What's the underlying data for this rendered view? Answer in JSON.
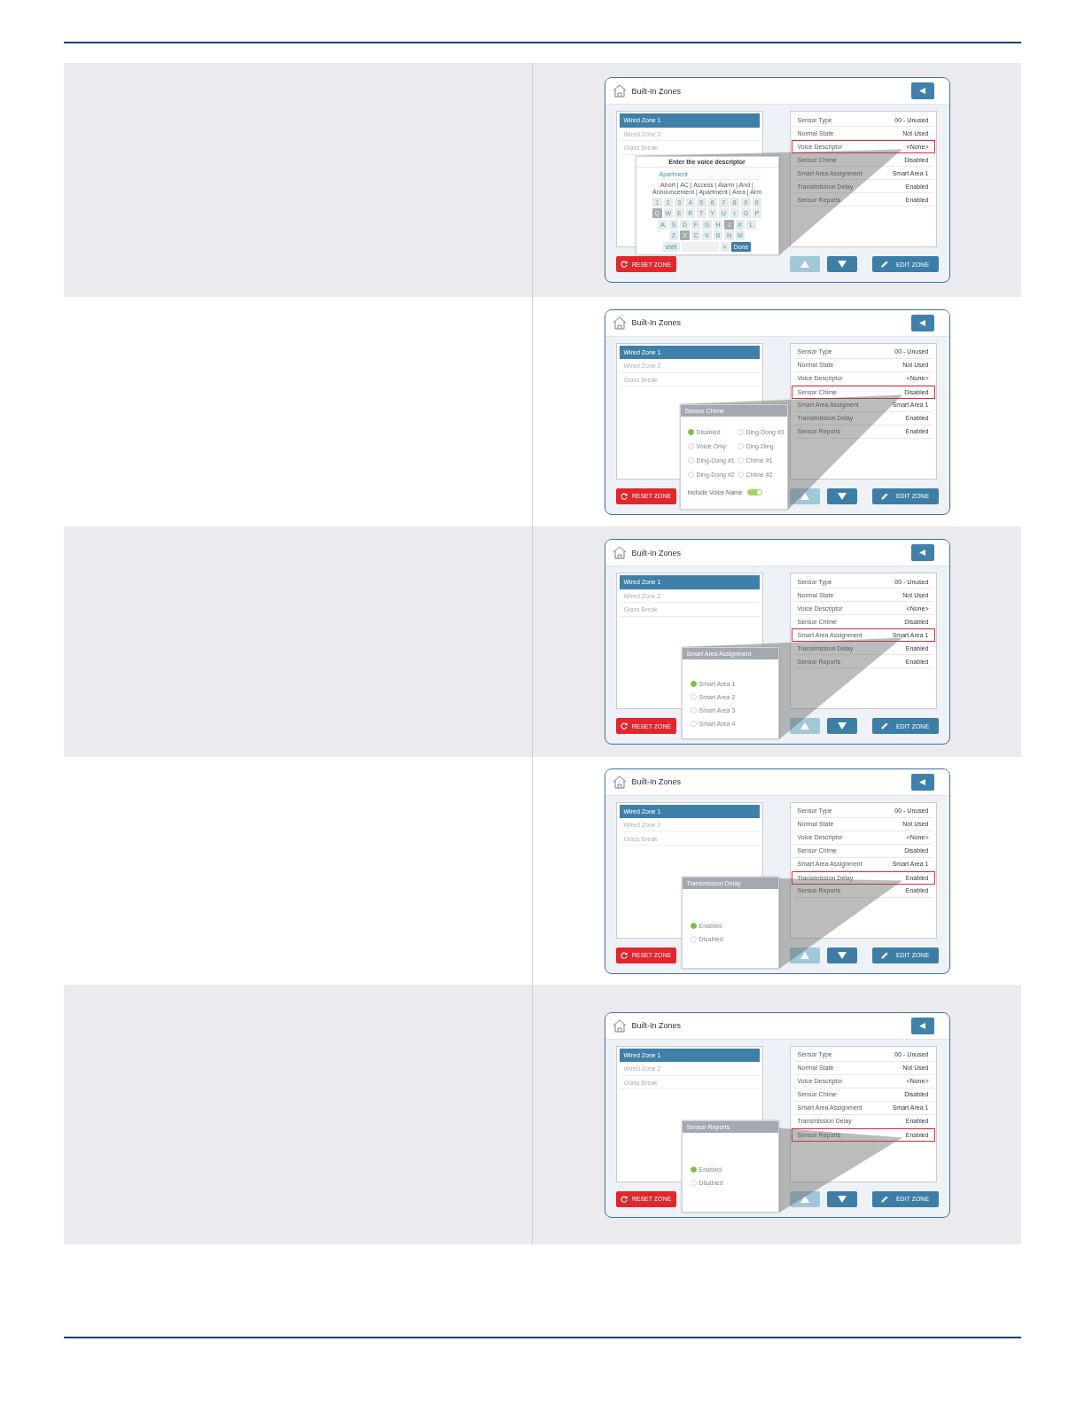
{
  "table": {
    "rows": [
      {
        "screen": {
          "title": "Built-In Zones",
          "zones": [
            {
              "label": "Wired Zone 1",
              "selected": true
            },
            {
              "label": "Wired Zone 2",
              "selected": false
            },
            {
              "label": "Glass Break",
              "selected": false
            }
          ],
          "settings": [
            {
              "label": "Sensor Type",
              "value": "00 - Unused",
              "highlighted": false
            },
            {
              "label": "Normal State",
              "value": "Not Used",
              "highlighted": false
            },
            {
              "label": "Voice Descriptor",
              "value": "<None>",
              "highlighted": true
            },
            {
              "label": "Sensor Chime",
              "value": "Disabled",
              "highlighted": false
            },
            {
              "label": "Smart Area Assignment",
              "value": "Smart Area 1",
              "highlighted": false
            },
            {
              "label": "Transimission Delay",
              "value": "Enabled",
              "highlighted": false
            },
            {
              "label": "Sensor Reports",
              "value": "Enabled",
              "highlighted": false
            }
          ],
          "reset_button": "RESET ZONE",
          "up_button": {
            "disabled": true
          },
          "down_button": {
            "disabled": false
          },
          "edit_button": "EDIT ZONE",
          "popup": {
            "kind": "keyboard",
            "title": "Enter the voice descriptor",
            "input_value": "Apartment",
            "suggestions": "Abort | AC | Access | Alarm | And | Announcement | Apartment | Area | Arm",
            "key_rows": [
              [
                {
                  "label": "1",
                  "highlighted": false
                },
                {
                  "label": "2",
                  "highlighted": false
                },
                {
                  "label": "3",
                  "highlighted": false
                },
                {
                  "label": "4",
                  "highlighted": false
                },
                {
                  "label": "5",
                  "highlighted": false
                },
                {
                  "label": "6",
                  "highlighted": false
                },
                {
                  "label": "7",
                  "highlighted": false
                },
                {
                  "label": "8",
                  "highlighted": false
                },
                {
                  "label": "9",
                  "highlighted": false
                },
                {
                  "label": "0",
                  "highlighted": false
                }
              ],
              [
                {
                  "label": "Q",
                  "highlighted": true
                },
                {
                  "label": "W",
                  "highlighted": false
                },
                {
                  "label": "E",
                  "highlighted": false
                },
                {
                  "label": "R",
                  "highlighted": false
                },
                {
                  "label": "T",
                  "highlighted": false
                },
                {
                  "label": "Y",
                  "highlighted": false
                },
                {
                  "label": "U",
                  "highlighted": false
                },
                {
                  "label": "I",
                  "highlighted": false
                },
                {
                  "label": "O",
                  "highlighted": false
                },
                {
                  "label": "P",
                  "highlighted": false
                }
              ],
              [
                {
                  "label": "A",
                  "highlighted": false
                },
                {
                  "label": "S",
                  "highlighted": false
                },
                {
                  "label": "D",
                  "highlighted": false
                },
                {
                  "label": "F",
                  "highlighted": false
                },
                {
                  "label": "G",
                  "highlighted": false
                },
                {
                  "label": "H",
                  "highlighted": false
                },
                {
                  "label": "J",
                  "highlighted": true
                },
                {
                  "label": "K",
                  "highlighted": false
                },
                {
                  "label": "L",
                  "highlighted": false
                }
              ],
              [
                {
                  "label": "Z",
                  "highlighted": false
                },
                {
                  "label": "X",
                  "highlighted": true
                },
                {
                  "label": "C",
                  "highlighted": false
                },
                {
                  "label": "V",
                  "highlighted": false
                },
                {
                  "label": "B",
                  "highlighted": false
                },
                {
                  "label": "N",
                  "highlighted": false
                },
                {
                  "label": "M",
                  "highlighted": false
                }
              ]
            ],
            "bottom_keys": [
              {
                "kind": "key",
                "label": "shift"
              },
              {
                "kind": "space"
              },
              {
                "kind": "key",
                "label": "×"
              },
              {
                "kind": "done",
                "label": "Done"
              }
            ]
          }
        }
      },
      {
        "screen": {
          "title": "Built-In Zones",
          "zones": [
            {
              "label": "Wired Zone 1",
              "selected": true
            },
            {
              "label": "Wired Zone 2",
              "selected": false
            },
            {
              "label": "Glass Break",
              "selected": false
            }
          ],
          "settings": [
            {
              "label": "Sensor Type",
              "value": "00 - Unused",
              "highlighted": false
            },
            {
              "label": "Normal State",
              "value": "Not Used",
              "highlighted": false
            },
            {
              "label": "Voice Descriptor",
              "value": "<None>",
              "highlighted": false
            },
            {
              "label": "Sensor Chime",
              "value": "Disabled",
              "highlighted": true
            },
            {
              "label": "Smart Area Assigment",
              "value": "Smart Area 1",
              "highlighted": false
            },
            {
              "label": "Transimission Delay",
              "value": "Enabled",
              "highlighted": false
            },
            {
              "label": "Sensor Reports",
              "value": "Enabled",
              "highlighted": false
            }
          ],
          "reset_button": "RESET ZONE",
          "up_button": {
            "disabled": true
          },
          "down_button": {
            "disabled": false
          },
          "edit_button": "EDIT ZONE",
          "popup": {
            "kind": "radio_grid",
            "title": "Sensor Chime",
            "options": [
              {
                "label": "Disabled",
                "selected": true
              },
              {
                "label": "Voice Only",
                "selected": false
              },
              {
                "label": "Ding-Dong #1",
                "selected": false
              },
              {
                "label": "Ding-Dong #2",
                "selected": false
              },
              {
                "label": "Ding-Dong #3",
                "selected": false
              },
              {
                "label": "Ding-Ding",
                "selected": false
              },
              {
                "label": "Chime #1",
                "selected": false
              },
              {
                "label": "Chime #2",
                "selected": false
              }
            ],
            "toggle": {
              "label": "Include Voice Name",
              "on": true
            }
          }
        }
      },
      {
        "screen": {
          "title": "Built-In Zones",
          "zones": [
            {
              "label": "Wired Zone 1",
              "selected": true
            },
            {
              "label": "Wired Zone 2",
              "selected": false
            },
            {
              "label": "Glass Break",
              "selected": false
            }
          ],
          "settings": [
            {
              "label": "Sensor Type",
              "value": "00 - Unused",
              "highlighted": false
            },
            {
              "label": "Normal State",
              "value": "Not Used",
              "highlighted": false
            },
            {
              "label": "Voice Descriptor",
              "value": "<None>",
              "highlighted": false
            },
            {
              "label": "Sensor Chime",
              "value": "Disabled",
              "highlighted": false
            },
            {
              "label": "Smart Area Assignment",
              "value": "Smart Area 1",
              "highlighted": true
            },
            {
              "label": "Transimission Delay",
              "value": "Enabled",
              "highlighted": false
            },
            {
              "label": "Sensor Reports",
              "value": "Enabled",
              "highlighted": false
            }
          ],
          "reset_button": "RESET ZONE",
          "up_button": {
            "disabled": true
          },
          "down_button": {
            "disabled": false
          },
          "edit_button": "EDIT ZONE",
          "popup": {
            "kind": "radio_list",
            "title": "Smart Area Assignment",
            "options": [
              {
                "label": "Smart Area 1",
                "selected": true
              },
              {
                "label": "Smart Area 2",
                "selected": false
              },
              {
                "label": "Smart Area 3",
                "selected": false
              },
              {
                "label": "Smart Area 4",
                "selected": false
              }
            ]
          }
        }
      },
      {
        "screen": {
          "title": "Built-In Zones",
          "zones": [
            {
              "label": "Wired Zone 1",
              "selected": true
            },
            {
              "label": "Wired Zone 2",
              "selected": false
            },
            {
              "label": "Glass Break",
              "selected": false
            }
          ],
          "settings": [
            {
              "label": "Sensor Type",
              "value": "00 - Unused",
              "highlighted": false
            },
            {
              "label": "Normal State",
              "value": "Not Used",
              "highlighted": false
            },
            {
              "label": "Voice Descriptor",
              "value": "<None>",
              "highlighted": false
            },
            {
              "label": "Sensor Chime",
              "value": "Disabled",
              "highlighted": false
            },
            {
              "label": "Smart Area Assignment",
              "value": "Smart Area 1",
              "highlighted": false
            },
            {
              "label": "Transimission Delay",
              "value": "Enabled",
              "highlighted": true
            },
            {
              "label": "Sensor Reports",
              "value": "Enabled",
              "highlighted": false
            }
          ],
          "reset_button": "RESET ZONE",
          "up_button": {
            "disabled": true
          },
          "down_button": {
            "disabled": false
          },
          "edit_button": "EDIT ZONE",
          "popup": {
            "kind": "radio_list",
            "title": "Transmission Delay",
            "options": [
              {
                "label": "Enabled",
                "selected": true
              },
              {
                "label": "Disabled",
                "selected": false
              }
            ]
          }
        }
      },
      {
        "screen": {
          "title": "Built-In Zones",
          "zones": [
            {
              "label": "Wired Zone 1",
              "selected": true
            },
            {
              "label": "Wired Zone 2",
              "selected": false
            },
            {
              "label": "Glass Break",
              "selected": false
            }
          ],
          "settings": [
            {
              "label": "Sensor Type",
              "value": "00 - Unused",
              "highlighted": false
            },
            {
              "label": "Normal State",
              "value": "Not Used",
              "highlighted": false
            },
            {
              "label": "Voice Descriptor",
              "value": "<None>",
              "highlighted": false
            },
            {
              "label": "Sensor Chime",
              "value": "Disabled",
              "highlighted": false
            },
            {
              "label": "Smart Area Assignment",
              "value": "Smart Area 1",
              "highlighted": false
            },
            {
              "label": "Transmission Delay",
              "value": "Enabled",
              "highlighted": false
            },
            {
              "label": "Sensor Reports",
              "value": "Enabled",
              "highlighted": true
            }
          ],
          "reset_button": "RESET ZONE",
          "up_button": {
            "disabled": true
          },
          "down_button": {
            "disabled": false
          },
          "edit_button": "EDIT ZONE",
          "popup": {
            "kind": "radio_list",
            "title": "Sensor Reports",
            "options": [
              {
                "label": "Enabled",
                "selected": true
              },
              {
                "label": "Disabled",
                "selected": false
              }
            ]
          }
        }
      }
    ]
  }
}
